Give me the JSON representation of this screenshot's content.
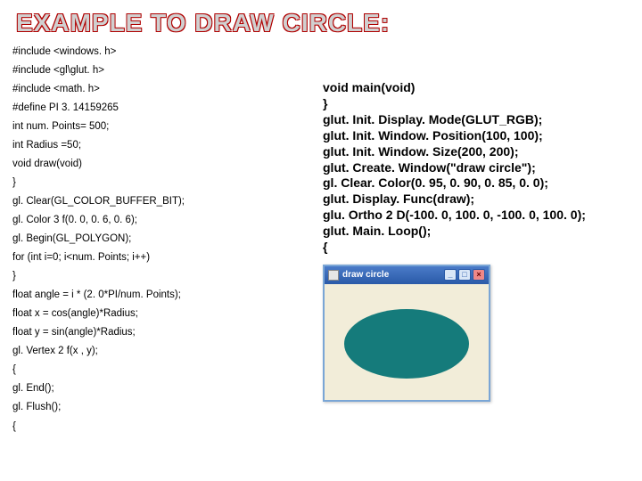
{
  "title": "EXAMPLE TO DRAW CIRCLE:",
  "left_code": [
    "#include <windows. h>",
    "#include <gl\\glut. h>",
    "#include <math. h>",
    "#define PI 3. 14159265",
    "int num. Points= 500;",
    "int Radius =50;",
    "void draw(void)",
    "}",
    "gl. Clear(GL_COLOR_BUFFER_BIT);",
    "gl. Color 3 f(0. 0, 0. 6, 0. 6);",
    "gl. Begin(GL_POLYGON);",
    "for (int i=0; i<num. Points; i++)",
    "}",
    "float angle = i * (2. 0*PI/num. Points);",
    "float x = cos(angle)*Radius;",
    "float y = sin(angle)*Radius;",
    "gl. Vertex 2 f(x , y);",
    "{",
    "gl. End();",
    "gl. Flush();",
    "{"
  ],
  "right_code": [
    "void main(void)",
    "}",
    "glut. Init. Display. Mode(GLUT_RGB);",
    "glut. Init. Window. Position(100, 100);",
    "glut. Init. Window. Size(200, 200);",
    "glut. Create. Window(\"draw circle\");",
    "gl. Clear. Color(0. 95, 0. 90, 0. 85, 0. 0);",
    "glut. Display. Func(draw);",
    "glu. Ortho 2 D(-100. 0, 100. 0, -100. 0, 100. 0);",
    "glut. Main. Loop();",
    "{"
  ],
  "window": {
    "title": "draw circle",
    "min": "_",
    "max": "□",
    "close": "×"
  }
}
